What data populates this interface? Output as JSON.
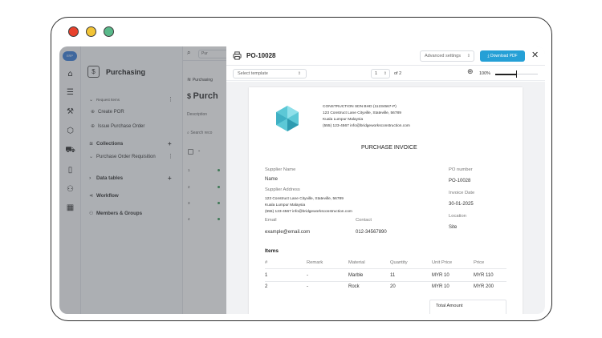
{
  "app": {
    "logo_text": "ERP"
  },
  "background": {
    "module_title": "Purchasing",
    "nav": {
      "request_items_label": "Request Items",
      "create_por": "Create POR",
      "issue_po": "Issue Purchase Order",
      "collections": "Collections",
      "po_requisition": "Purchase Order Requisition",
      "data_tables": "Data tables",
      "workflow": "Workflow",
      "members_groups": "Members & Groups"
    },
    "main": {
      "search_placeholder": "Pur",
      "breadcrumb": "Purchasing",
      "title": "Purch",
      "description_label": "Description",
      "search_records": "Search reco",
      "rows": [
        "1",
        "2",
        "3",
        "4"
      ]
    }
  },
  "modal": {
    "title": "PO-10028",
    "advanced_settings": "Advanced settings",
    "download_label": "Download PDF",
    "select_template_placeholder": "Select template",
    "page_current": "1",
    "page_of": "of 2",
    "zoom_label": "100%",
    "zoom_value": 0.5
  },
  "invoice": {
    "company": {
      "name": "CONSTRUCTION SDN BHD (11234567-P)",
      "address1": "123 Construct Lane Cityville, Stateville, 56789",
      "address2": "Kuala Lumpur Malaysia",
      "contact": "(555) 123-4567 info@bridgeworksconstruction.com"
    },
    "doc_title": "PURCHASE INVOICE",
    "supplier_name_label": "Supplier Name",
    "supplier_name": "Name",
    "supplier_address_label": "Supplier Address",
    "supplier_address1": "123 Construct Lane Cityville, Stateville, 56789",
    "supplier_address2": "Kuala Lumpur Malaysia",
    "supplier_address3": "(555) 123-4567 info@bridgeworksconstruction.com",
    "email_label": "Email",
    "email": "example@email.com",
    "contact_label": "Contact",
    "contact": "012-34567890",
    "po_number_label": "PO number",
    "po_number": "PO-10028",
    "invoice_date_label": "Invoice Date",
    "invoice_date": "30-01-2025",
    "location_label": "Location",
    "location": "Site",
    "items_heading": "Items",
    "columns": [
      "#",
      "Remark",
      "Material",
      "Quantity",
      "Unit Price",
      "Price"
    ],
    "rows": [
      [
        "1",
        "-",
        "Marble",
        "11",
        "MYR 10",
        "MYR 110"
      ],
      [
        "2",
        "-",
        "Rock",
        "20",
        "MYR 10",
        "MYR 200"
      ]
    ],
    "total_label": "Total Amount"
  }
}
